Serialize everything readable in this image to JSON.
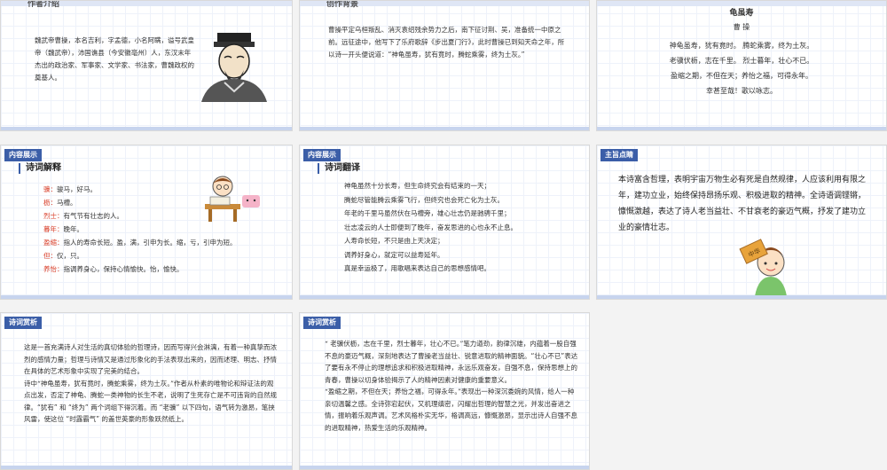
{
  "slide1": {
    "title_fragment": "作者介绍",
    "text": "魏武帝曹操，本名吉利，字孟德，小名阿瞒，谥号武皇帝（魏武帝），沛国谯县（今安徽亳州）人，东汉末年杰出的政治家、军事家、文学家、书法家，曹魏政权的奠基人。"
  },
  "slide2": {
    "title_fragment": "创作背景",
    "text": "曹操平定乌桓叛乱、消灭袁绍残余势力之后，南下征讨荆、吴，准备统一中原之前。远征途中，他写下了乐府歌辞《步出夏门行》，此时曹操已到知天命之年，所以诗一开头便说道：“神龟虽寿，犹有竟时，腾蛇乘雾，终为土灰。”"
  },
  "slide3": {
    "poem_title": "龟虽寿",
    "author": "曹  操",
    "lines": [
      "神龟虽寿，犹有竟时。 腾蛇乘雾，终为土灰。",
      "老骥伏枥，志在千里。 烈士暮年，壮心不已。",
      "盈缩之期，不但在天；养怡之福，可得永年。",
      "幸甚至哉！歌以咏志。"
    ]
  },
  "slide4": {
    "tag": "内容展示",
    "subtitle": "诗词解释",
    "terms": [
      {
        "word": "骥：",
        "def": "骏马，好马。"
      },
      {
        "word": "枥：",
        "def": "马槽。"
      },
      {
        "word": "烈士：",
        "def": "有气节有壮志的人。"
      },
      {
        "word": "暮年：",
        "def": "晚年。"
      },
      {
        "word": "盈缩：",
        "def": "指人的寿命长短。盈，满，引申为长。缩，亏，引申为短。"
      },
      {
        "word": "但：",
        "def": "仅，只。"
      },
      {
        "word": "养怡：",
        "def": "指调养身心，保持心情愉快。怡，愉快。"
      }
    ]
  },
  "slide5": {
    "tag": "内容展示",
    "subtitle": "诗词翻译",
    "lines": [
      "神龟虽然十分长寿，但生命终究会有结束的一天；",
      "腾蛇尽管能腾云乘雾飞行，但终究也会死亡化为土灰。",
      "年老的千里马虽然伏在马槽旁，雄心壮志仍是驰骋千里；",
      "壮志凌云的人士即便到了晚年，奋发思进的心也永不止息。",
      "人寿命长短，不只是由上天决定；",
      "调养好身心，就定可以益寿延年。",
      "真是幸运极了，用歌唱来表达自己的思想感情吧。"
    ]
  },
  "slide6": {
    "tag": "主旨点睛",
    "text": "本诗富含哲理，表明宇宙万物生必有死是自然规律，人应该利用有限之年，建功立业，始终保持昂扬乐观、积极进取的精神。全诗语调铿锵，慷慨激越，表达了诗人老当益壮、不甘衰老的豪迈气概，抒发了建功立业的豪情壮志。",
    "sign": "中华"
  },
  "slide7": {
    "tag": "诗词赏析",
    "p1": "这是一首充满诗人对生活的真切体验的哲理诗，因而写得兴会淋漓，有着一种真挚而浓烈的感情力量；哲理与诗情又是通过形象化的手法表现出来的，因而述理、明志、抒情在具体的艺术形象中实现了完美的结合。",
    "p2_pre": "诗中",
    "p2_quote": "“神龟虽寿，犹有竟时，腾蛇乘雾，终为土灰。”",
    "p2_post": "作者从朴素的唯物论和辩证法的观点出发，否定了神龟、腾蛇一类神物的长生不老，说明了生死存亡是不可违背的自然规律。“犹有” 和 “终为” 两个词组下得沉着。而 “老骥” 以下四句，语气转为激昂，笔挟风雷，使这位 “时露霸气” 的盖世英豪的形象跃然纸上。"
  },
  "slide8": {
    "tag": "诗词赏析",
    "q1": "“ 老骥伏枥，志在千里，烈士暮年，壮心不已。”",
    "t1": "笔力遒劲，韵律沉雄，内蕴着一股自强不息的豪迈气概，深刻地表达了曹操老当益壮、锐意进取的精神面貌。“壮心不已”表达了要有永不停止的理想追求和积极进取精神，永远乐观奋发，自强不息，保持思想上的青春，曹操以切身体验揭示了人的精神因素对健康的重要意义。",
    "q2": "“盈缩之期，不但在天；养怡之福，可得永年。”",
    "t2": "表现出一种深沉委婉的风情，给人一种亲切温馨之感。全诗弥宕起伏，又机理缜密，闪耀出哲理的智慧之光，并发出奋进之情，振响着乐观声调。艺术风格朴实无华，格调高远，慷慨激昂，显示出诗人自强不息的进取精神，热爱生活的乐观精神。"
  }
}
